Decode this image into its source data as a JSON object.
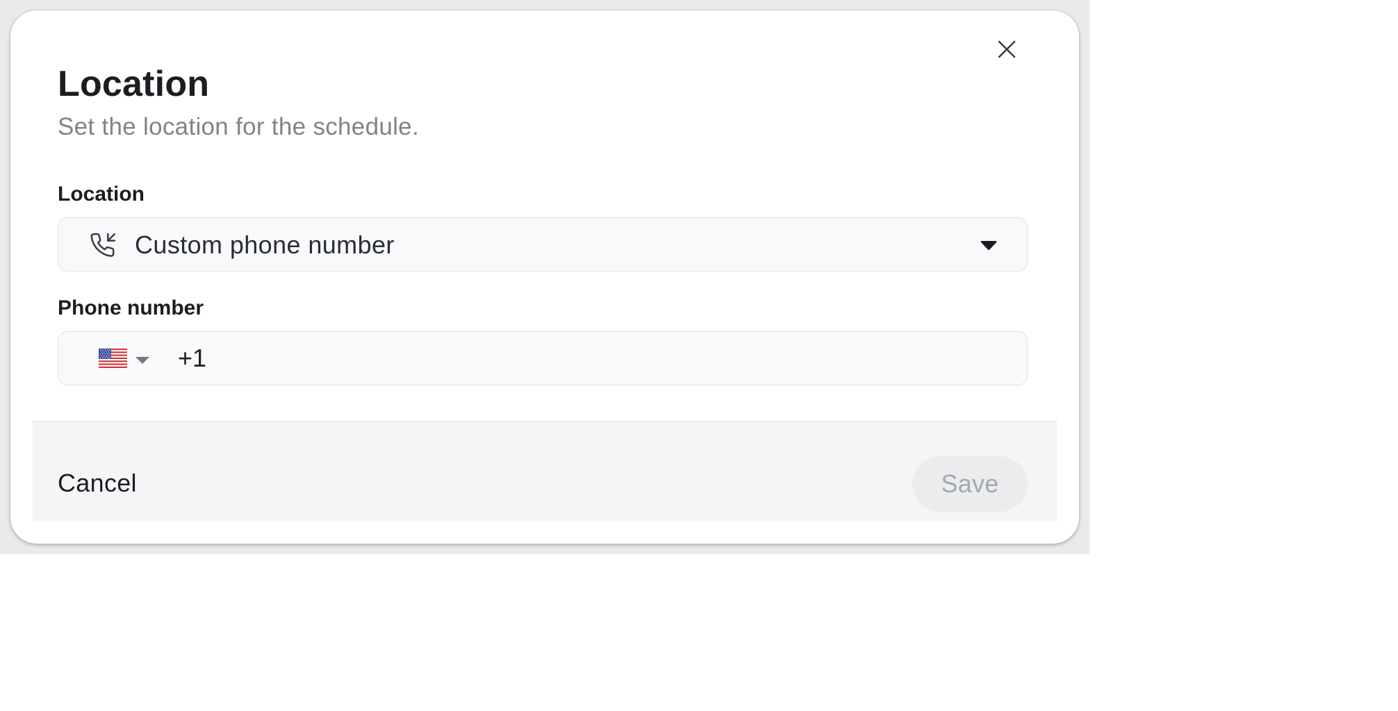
{
  "dialog": {
    "title": "Location",
    "subtitle": "Set the location for the schedule.",
    "close_icon": "close-icon"
  },
  "location_field": {
    "label": "Location",
    "selected_value": "Custom phone number",
    "icon": "phone-incoming-icon"
  },
  "phone_field": {
    "label": "Phone number",
    "country_flag": "us-flag-icon",
    "value": "+1"
  },
  "footer": {
    "cancel_label": "Cancel",
    "save_label": "Save",
    "save_enabled": false
  },
  "colors": {
    "text_primary": "#1b1d21",
    "text_secondary": "#7f848b",
    "field_background": "#f8f9fa",
    "field_border": "#dfe1e4",
    "footer_background": "#f4f5f7",
    "save_disabled_background": "#ebecee",
    "save_disabled_text": "#a4a8ae"
  }
}
